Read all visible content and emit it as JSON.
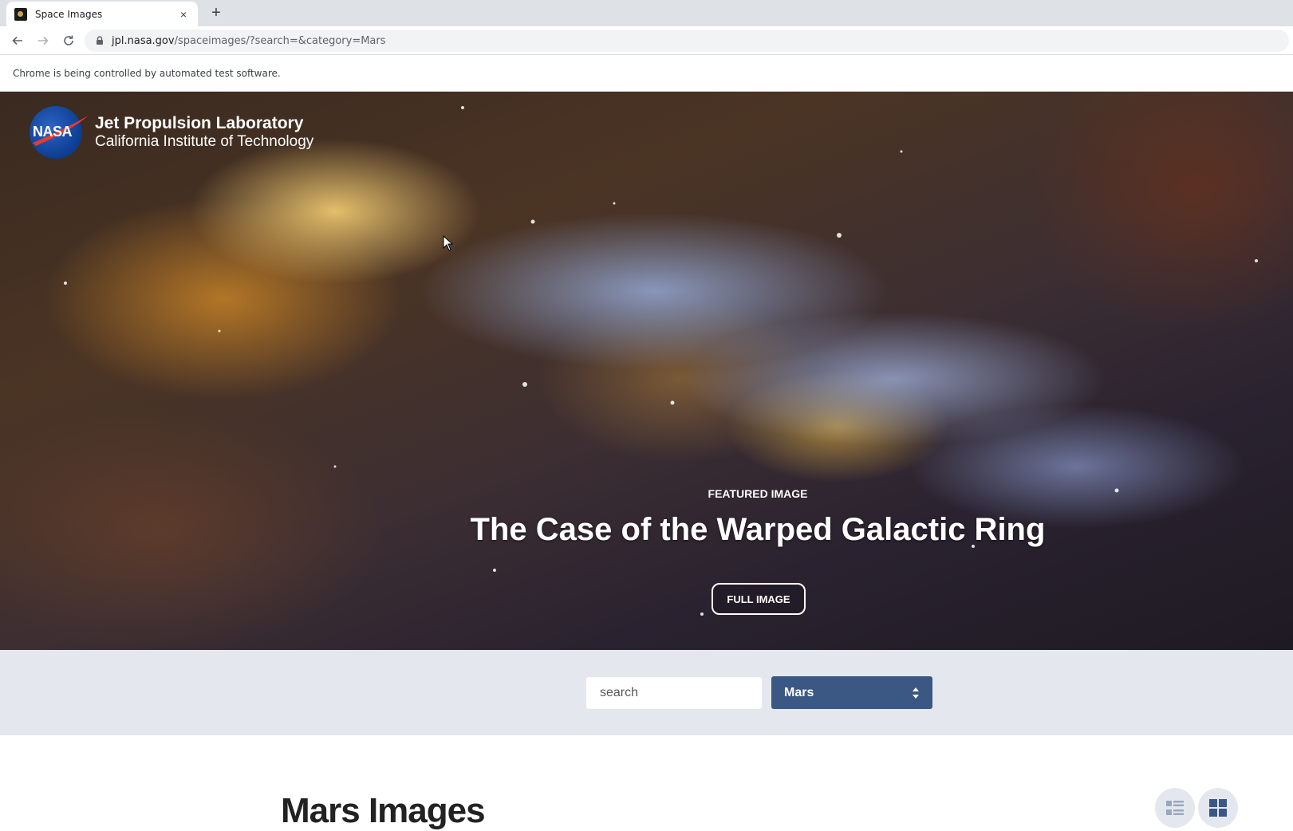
{
  "browser": {
    "tab_title": "Space Images",
    "new_tab_symbol": "+",
    "close_symbol": "×",
    "url_host": "jpl.nasa.gov",
    "url_path": "/spaceimages/?search=&category=Mars",
    "infobar_text": "Chrome is being controlled by automated test software."
  },
  "header": {
    "logo_nasa_text": "NASA",
    "lab_name": "Jet Propulsion Laboratory",
    "institute": "California Institute of Technology"
  },
  "hero": {
    "kicker": "FEATURED IMAGE",
    "title": "The Case of the Warped Galactic Ring",
    "button_label": "FULL IMAGE"
  },
  "filters": {
    "search_placeholder": "search",
    "search_value": "",
    "category_selected": "Mars"
  },
  "content": {
    "section_title": "Mars Images"
  },
  "icons": {
    "back": "back-arrow-icon",
    "forward": "forward-arrow-icon",
    "reload": "reload-icon",
    "lock": "lock-icon",
    "search": "search-icon",
    "list_view": "list-view-icon",
    "grid_view": "grid-view-icon"
  },
  "colors": {
    "filter_bar_bg": "#e4e8ee",
    "select_bg": "#3b5783",
    "title_text": "#222222"
  }
}
